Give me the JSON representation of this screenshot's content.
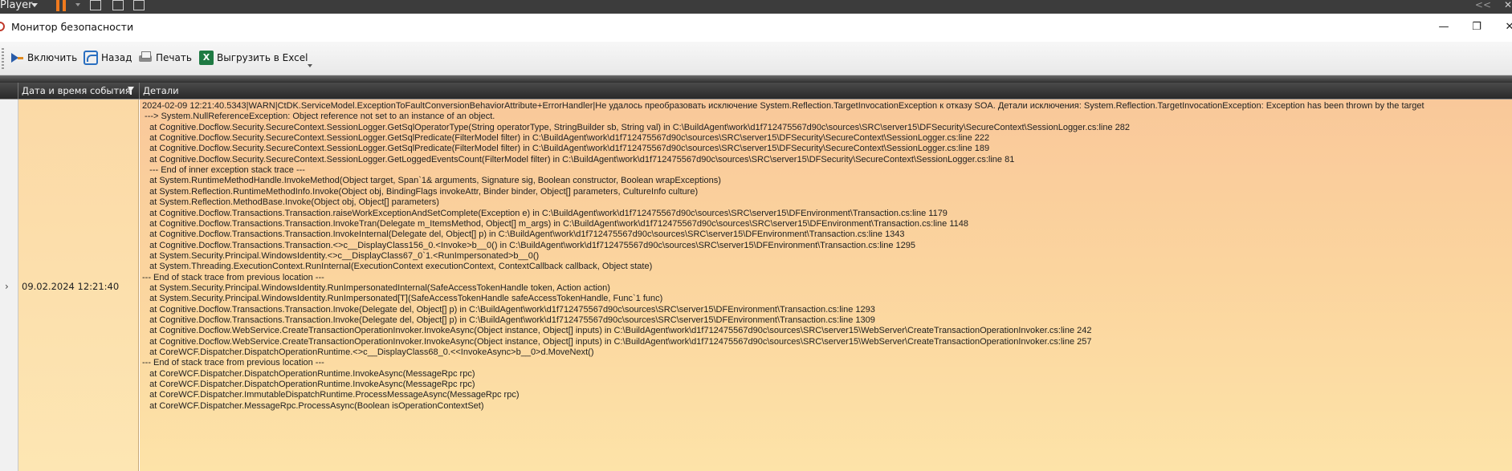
{
  "playerbar": {
    "label": "Player"
  },
  "window": {
    "title": "Монитор безопасности"
  },
  "toolbar": {
    "enable_label": "Включить",
    "back_label": "Назад",
    "print_label": "Печать",
    "export_label": "Выгрузить в Excel"
  },
  "grid": {
    "columns": [
      "Дата и время события",
      "Детали"
    ],
    "row": {
      "date": "09.02.2024 12:21:40",
      "details": [
        "2024-02-09 12:21:40.5343|WARN|CtDK.ServiceModel.ExceptionToFaultConversionBehaviorAttribute+ErrorHandler|Не удалось преобразовать исключение System.Reflection.TargetInvocationException к отказу SOA. Детали исключения: System.Reflection.TargetInvocationException: Exception has been thrown by the target",
        " ---> System.NullReferenceException: Object reference not set to an instance of an object.",
        "   at Cognitive.Docflow.Security.SecureContext.SessionLogger.GetSqlOperatorType(String operatorType, StringBuilder sb, String val) in C:\\BuildAgent\\work\\d1f712475567d90c\\sources\\SRC\\server15\\DFSecurity\\SecureContext\\SessionLogger.cs:line 282",
        "   at Cognitive.Docflow.Security.SecureContext.SessionLogger.GetSqlPredicate(FilterModel filter) in C:\\BuildAgent\\work\\d1f712475567d90c\\sources\\SRC\\server15\\DFSecurity\\SecureContext\\SessionLogger.cs:line 222",
        "   at Cognitive.Docflow.Security.SecureContext.SessionLogger.GetSqlPredicate(FilterModel filter) in C:\\BuildAgent\\work\\d1f712475567d90c\\sources\\SRC\\server15\\DFSecurity\\SecureContext\\SessionLogger.cs:line 189",
        "   at Cognitive.Docflow.Security.SecureContext.SessionLogger.GetLoggedEventsCount(FilterModel filter) in C:\\BuildAgent\\work\\d1f712475567d90c\\sources\\SRC\\server15\\DFSecurity\\SecureContext\\SessionLogger.cs:line 81",
        "   --- End of inner exception stack trace ---",
        "   at System.RuntimeMethodHandle.InvokeMethod(Object target, Span`1& arguments, Signature sig, Boolean constructor, Boolean wrapExceptions)",
        "   at System.Reflection.RuntimeMethodInfo.Invoke(Object obj, BindingFlags invokeAttr, Binder binder, Object[] parameters, CultureInfo culture)",
        "   at System.Reflection.MethodBase.Invoke(Object obj, Object[] parameters)",
        "   at Cognitive.Docflow.Transactions.Transaction.raiseWorkExceptionAndSetComplete(Exception e) in C:\\BuildAgent\\work\\d1f712475567d90c\\sources\\SRC\\server15\\DFEnvironment\\Transaction.cs:line 1179",
        "   at Cognitive.Docflow.Transactions.Transaction.InvokeTran(Delegate m_ItemsMethod, Object[] m_args) in C:\\BuildAgent\\work\\d1f712475567d90c\\sources\\SRC\\server15\\DFEnvironment\\Transaction.cs:line 1148",
        "   at Cognitive.Docflow.Transactions.Transaction.InvokeInternal(Delegate del, Object[] p) in C:\\BuildAgent\\work\\d1f712475567d90c\\sources\\SRC\\server15\\DFEnvironment\\Transaction.cs:line 1343",
        "   at Cognitive.Docflow.Transactions.Transaction.<>c__DisplayClass156_0.<Invoke>b__0() in C:\\BuildAgent\\work\\d1f712475567d90c\\sources\\SRC\\server15\\DFEnvironment\\Transaction.cs:line 1295",
        "   at System.Security.Principal.WindowsIdentity.<>c__DisplayClass67_0`1.<RunImpersonated>b__0()",
        "   at System.Threading.ExecutionContext.RunInternal(ExecutionContext executionContext, ContextCallback callback, Object state)",
        "--- End of stack trace from previous location ---",
        "   at System.Security.Principal.WindowsIdentity.RunImpersonatedInternal(SafeAccessTokenHandle token, Action action)",
        "   at System.Security.Principal.WindowsIdentity.RunImpersonated[T](SafeAccessTokenHandle safeAccessTokenHandle, Func`1 func)",
        "   at Cognitive.Docflow.Transactions.Transaction.Invoke(Delegate del, Object[] p) in C:\\BuildAgent\\work\\d1f712475567d90c\\sources\\SRC\\server15\\DFEnvironment\\Transaction.cs:line 1293",
        "   at Cognitive.Docflow.Transactions.Transaction.Invoke(Delegate del, Object[] p) in C:\\BuildAgent\\work\\d1f712475567d90c\\sources\\SRC\\server15\\DFEnvironment\\Transaction.cs:line 1309",
        "   at Cognitive.Docflow.WebService.CreateTransactionOperationInvoker.InvokeAsync(Object instance, Object[] inputs) in C:\\BuildAgent\\work\\d1f712475567d90c\\sources\\SRC\\server15\\WebServer\\CreateTransactionOperationInvoker.cs:line 242",
        "   at Cognitive.Docflow.WebService.CreateTransactionOperationInvoker.InvokeAsync(Object instance, Object[] inputs) in C:\\BuildAgent\\work\\d1f712475567d90c\\sources\\SRC\\server15\\WebServer\\CreateTransactionOperationInvoker.cs:line 257",
        "   at CoreWCF.Dispatcher.DispatchOperationRuntime.<>c__DisplayClass68_0.<<InvokeAsync>b__0>d.MoveNext()",
        "--- End of stack trace from previous location ---",
        "   at CoreWCF.Dispatcher.DispatchOperationRuntime.InvokeAsync(MessageRpc rpc)",
        "   at CoreWCF.Dispatcher.DispatchOperationRuntime.InvokeAsync(MessageRpc rpc)",
        "   at CoreWCF.Dispatcher.ImmutableDispatchRuntime.ProcessMessageAsync(MessageRpc rpc)",
        "   at CoreWCF.Dispatcher.MessageRpc.ProcessAsync(Boolean isOperationContextSet)"
      ]
    }
  },
  "colors": {
    "row_highlight_top": "#f9c89a",
    "row_highlight_bottom": "#fde3a8",
    "header_bg": "#2a2a2a",
    "accent_pause": "#f07a1e"
  },
  "icons": [
    "pause-icon",
    "play-icon",
    "back-icon",
    "print-icon",
    "excel-icon",
    "filter-icon",
    "chevron-right-icon",
    "minimize-icon",
    "maximize-icon",
    "close-icon"
  ]
}
